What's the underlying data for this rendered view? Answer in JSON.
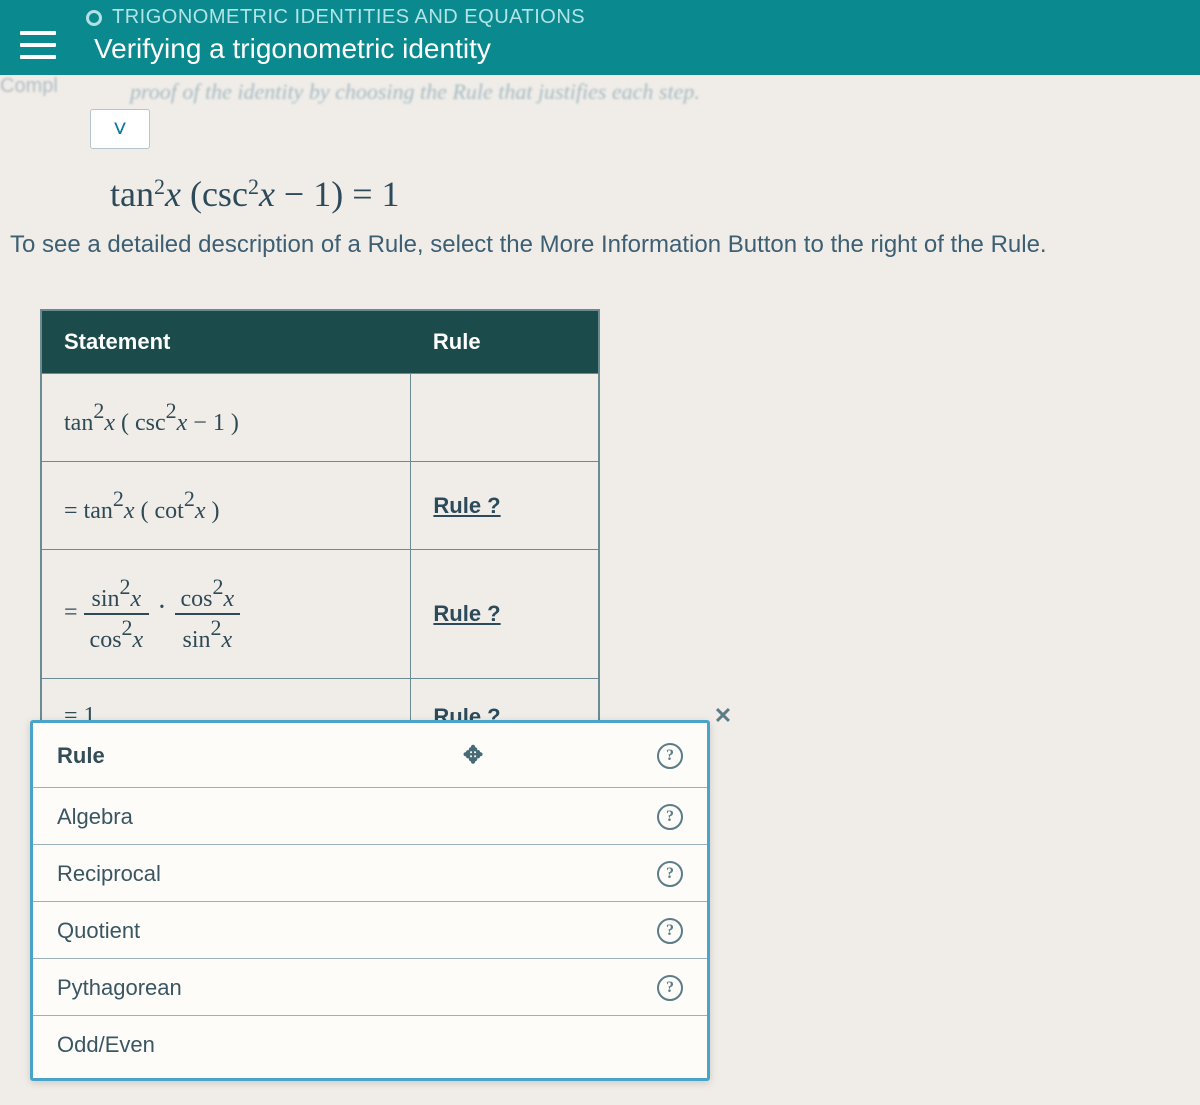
{
  "header": {
    "crumb": "TRIGONOMETRIC IDENTITIES AND EQUATIONS",
    "title": "Verifying a trigonometric identity"
  },
  "partial": {
    "compl": "Compl",
    "blurb": "proof of the identity by choosing the Rule that justifies each step."
  },
  "equation": "tan²x (csc²x − 1) = 1",
  "instruction": "To see a detailed description of a Rule, select the More Information Button to the right of the Rule.",
  "table": {
    "headers": {
      "statement": "Statement",
      "rule": "Rule"
    },
    "rows": [
      {
        "stmt_html": "tan<span class='sup'>2</span><i>x</i> ( csc<span class='sup'>2</span><i>x</i> − 1 )",
        "rule": ""
      },
      {
        "stmt_html": "= tan<span class='sup'>2</span><i>x</i> ( cot<span class='sup'>2</span><i>x</i> )",
        "rule": "Rule ?"
      },
      {
        "stmt_html": "= <span class='frac'><span class='num'>sin<span class='sup'>2</span><i>x</i></span><span class='den'>cos<span class='sup'>2</span><i>x</i></span></span><span class='dot'>·</span><span class='frac'><span class='num'>cos<span class='sup'>2</span><i>x</i></span><span class='den'>sin<span class='sup'>2</span><i>x</i></span></span>",
        "rule": "Rule ?"
      },
      {
        "stmt_html": "= 1",
        "rule": "Rule ?"
      }
    ]
  },
  "popup": {
    "title": "Rule",
    "close": "✕",
    "move": "✥",
    "items": [
      "Algebra",
      "Reciprocal",
      "Quotient",
      "Pythagorean",
      "Odd/Even"
    ]
  }
}
